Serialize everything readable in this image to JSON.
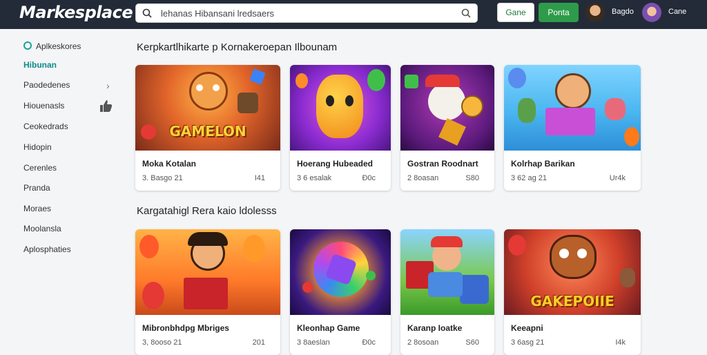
{
  "header": {
    "logo": "Markesplace",
    "search_text": "lehanas Hibansani lredsaers",
    "game_button": "Gane",
    "green_button": "Ponta",
    "user1_name": "Bagdo",
    "user2_name": "Cane"
  },
  "sidebar": {
    "items": [
      {
        "label": "Aplkeskores"
      },
      {
        "label": "Hibunan"
      },
      {
        "label": "Paodedenes"
      },
      {
        "label": "Hiouenasls"
      },
      {
        "label": "Ceokedrads"
      },
      {
        "label": "Hidopin"
      },
      {
        "label": "Cerenles"
      },
      {
        "label": "Pranda"
      },
      {
        "label": "Moraes"
      },
      {
        "label": "Moolansla"
      },
      {
        "label": "Aplosphaties"
      }
    ]
  },
  "sections": [
    {
      "title": "Kerpkartlhikarte p Kornakeroepan Ilbounam",
      "cards": [
        {
          "name": "Moka Kotalan",
          "meta": "3. Basgo 21",
          "stat": "I41",
          "art_text": "GAMELON"
        },
        {
          "name": "Hoerang Hubeaded",
          "meta": "3 6 esalak",
          "stat": "Ð0c",
          "art_text": ""
        },
        {
          "name": "Gostran Roodnart",
          "meta": "2 8oasan",
          "stat": "S80",
          "art_text": ""
        },
        {
          "name": "Kolrhap Barikan",
          "meta": "3 62 ag 21",
          "stat": "Ur4k",
          "art_text": ""
        }
      ]
    },
    {
      "title": "Kargatahigl Rera kaio ldolesss",
      "cards": [
        {
          "name": "Mibronbhdpg Mbriges",
          "meta": "3, 8ooso 21",
          "stat": "201",
          "art_text": ""
        },
        {
          "name": "Kleonhap Game",
          "meta": "3 8aeslan",
          "stat": "Ð0c",
          "art_text": ""
        },
        {
          "name": "Karanp Ioatke",
          "meta": "2 8osoan",
          "stat": "S60",
          "art_text": ""
        },
        {
          "name": "Keeapni",
          "meta": "3 6asg 21",
          "stat": "I4k",
          "art_text": "GAKEPOIIE"
        }
      ]
    }
  ],
  "colors": {
    "topbar": "#232b38",
    "accent_green": "#2e9b4a",
    "active_teal": "#0f8a8a"
  }
}
